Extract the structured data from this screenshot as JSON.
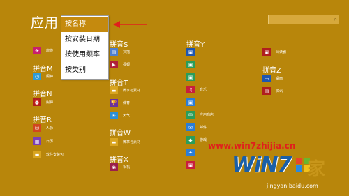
{
  "page": {
    "title": "应用"
  },
  "sort_menu": {
    "items": [
      {
        "label": "按名称",
        "selected": true
      },
      {
        "label": "按安装日期",
        "selected": false
      },
      {
        "label": "按使用频率",
        "selected": false
      },
      {
        "label": "按类别",
        "selected": false
      }
    ]
  },
  "colors": {
    "background": "#b8860b",
    "accent": "#c58a0e",
    "annotation_arrow": "#e0201c"
  },
  "groups": {
    "m": "拼音M",
    "n": "拼音N",
    "r": "拼音R",
    "s": "拼音S",
    "t": "拼音T",
    "w": "拼音W",
    "x": "拼音X",
    "y": "拼音Y",
    "z": "拼音Z"
  },
  "apps": {
    "lvyou": "旅游",
    "naozhong": "闹钟",
    "renmai": "人脉",
    "rili": "日历",
    "ruanjian": "软件安装包",
    "saomiao": "扫描",
    "shipin": "视频",
    "tiyu": "体育",
    "tianqi": "天气",
    "weixiang": "微享与素材",
    "xiangji": "相机",
    "yinyue": "音乐",
    "yingyong": "应用商店",
    "youjian": "邮件",
    "youxi": "游戏",
    "yanse": "阅读器",
    "zhuomian": "桌面",
    "zixun": "资讯"
  },
  "watermark": {
    "site": "www.win7zhijia.cn",
    "logo": "WiN7",
    "logo_suffix": "家",
    "baidu": "jingyan.baidu.com"
  }
}
